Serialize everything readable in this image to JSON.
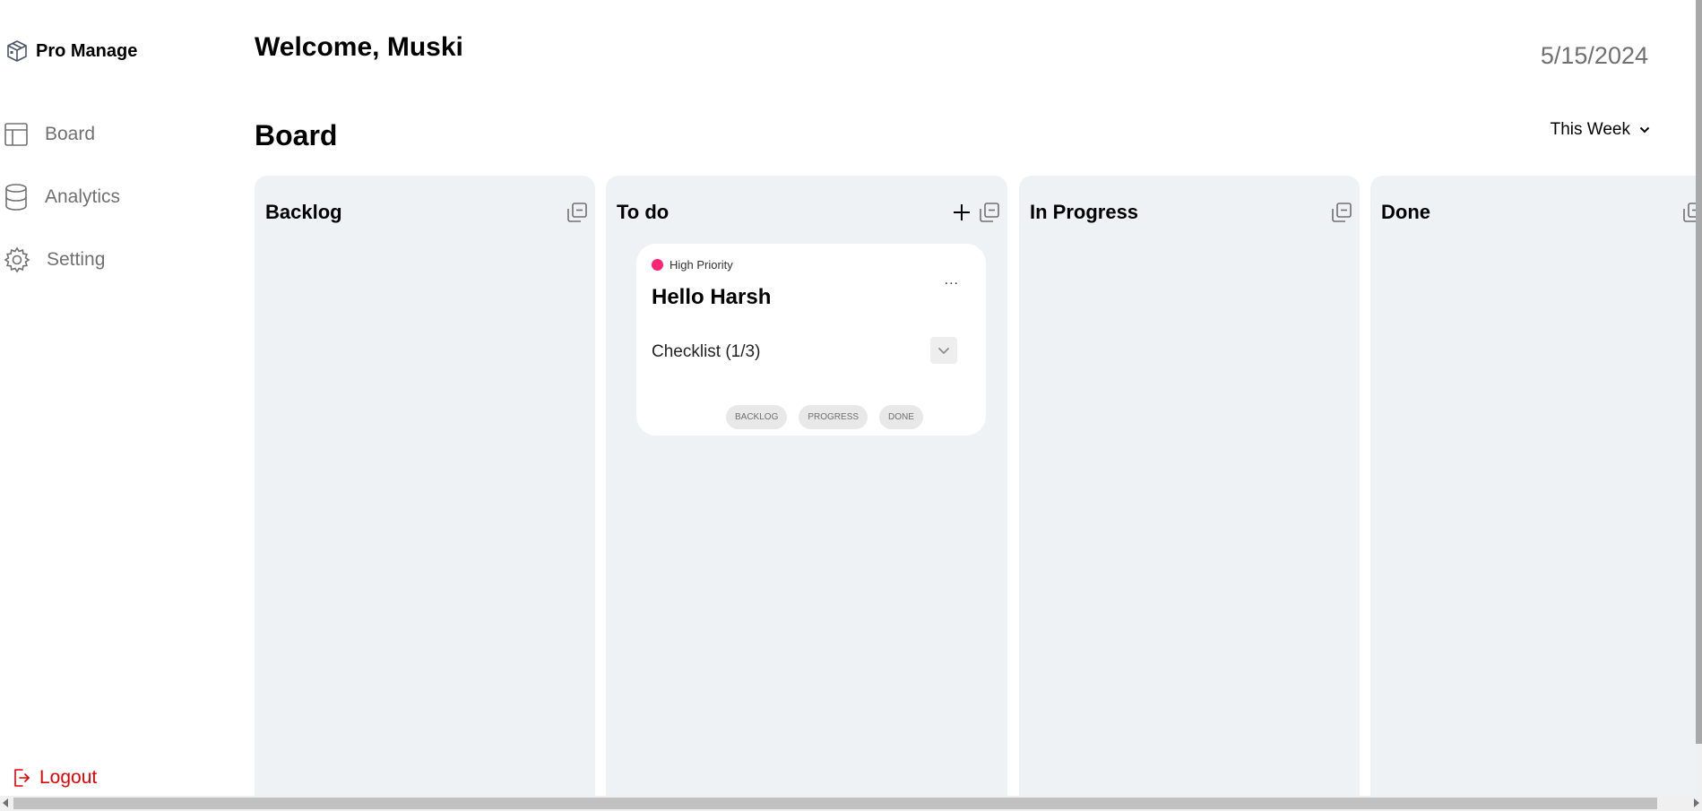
{
  "app": {
    "brand": "Pro Manage"
  },
  "sidebar": {
    "items": [
      {
        "label": "Board",
        "icon": "layout-icon"
      },
      {
        "label": "Analytics",
        "icon": "database-icon"
      },
      {
        "label": "Setting",
        "icon": "gear-icon"
      }
    ],
    "logout_label": "Logout"
  },
  "header": {
    "welcome": "Welcome, Muski",
    "date": "5/15/2024"
  },
  "board": {
    "title": "Board",
    "period_filter": "This Week",
    "columns": [
      {
        "title": "Backlog"
      },
      {
        "title": "To do"
      },
      {
        "title": "In Progress"
      },
      {
        "title": "Done"
      }
    ]
  },
  "card": {
    "priority": "High Priority",
    "title": "Hello Harsh",
    "menu": "...",
    "checklist": "Checklist (1/3)",
    "status_buttons": [
      "BACKLOG",
      "PROGRESS",
      "DONE"
    ]
  },
  "colors": {
    "logout": "#e60000",
    "priority_high": "#ff2473",
    "column_bg": "#eef2f5"
  }
}
